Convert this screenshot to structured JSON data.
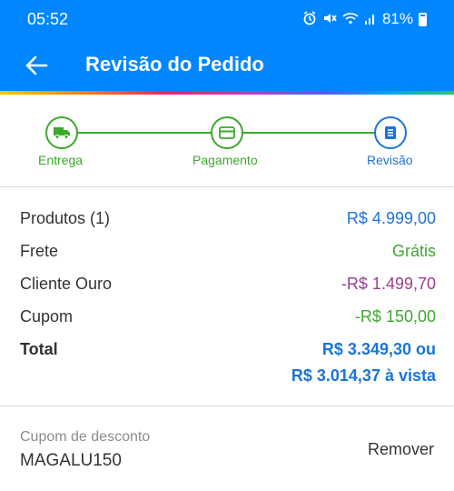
{
  "status_bar": {
    "time": "05:52",
    "battery": "81%",
    "icons": [
      "alarm-icon",
      "mute-icon",
      "wifi-icon",
      "signal-icon",
      "battery-icon"
    ]
  },
  "app_bar": {
    "title": "Revisão do Pedido",
    "back_icon": "arrow-left-icon"
  },
  "colors": {
    "header": "#0086ff",
    "step_done": "#3ca82c",
    "step_current": "#1b74d8",
    "price_blue": "#1b74d8",
    "free_green": "#3ca82c",
    "discount_purple": "#9b3c91"
  },
  "stepper": {
    "steps": [
      {
        "label": "Entrega",
        "icon": "truck-icon",
        "state": "done"
      },
      {
        "label": "Pagamento",
        "icon": "card-icon",
        "state": "done"
      },
      {
        "label": "Revisão",
        "icon": "receipt-icon",
        "state": "current"
      }
    ]
  },
  "summary": {
    "rows": [
      {
        "label": "Produtos (1)",
        "value": "R$ 4.999,00"
      },
      {
        "label": "Frete",
        "value": "Grátis"
      },
      {
        "label": "Cliente Ouro",
        "value": "-R$ 1.499,70"
      },
      {
        "label": "Cupom",
        "value": "-R$ 150,00"
      }
    ],
    "total": {
      "label": "Total",
      "value_line1": "R$ 3.349,30 ou",
      "value_line2": "R$ 3.014,37 à vista"
    }
  },
  "coupon": {
    "label": "Cupom de desconto",
    "code": "MAGALU150",
    "remove_label": "Remover"
  }
}
